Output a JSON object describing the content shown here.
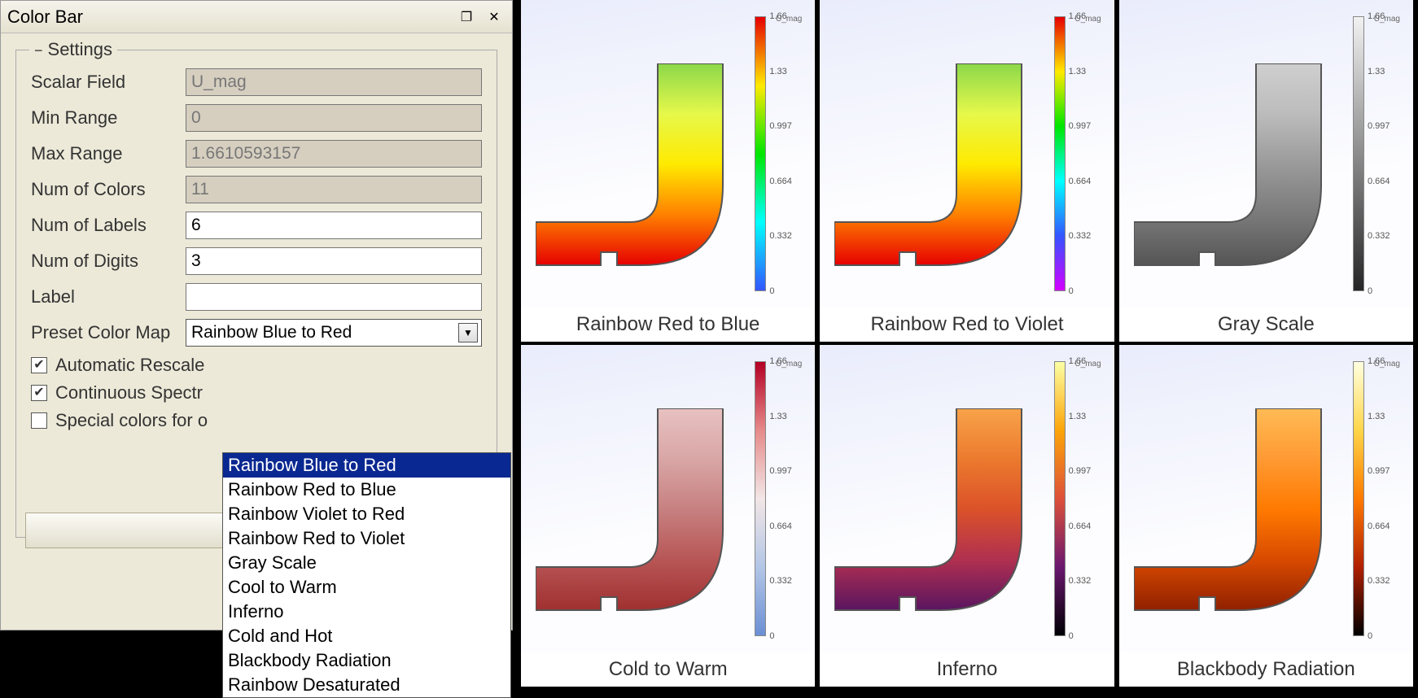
{
  "panel": {
    "title": "Color Bar",
    "group_title": "Settings",
    "fields": {
      "scalar_field": {
        "label": "Scalar Field",
        "value": "U_mag",
        "disabled": true
      },
      "min_range": {
        "label": "Min Range",
        "value": "0",
        "disabled": true
      },
      "max_range": {
        "label": "Max Range",
        "value": "1.6610593157",
        "disabled": true
      },
      "num_colors": {
        "label": "Num of Colors",
        "value": "11",
        "disabled": true
      },
      "num_labels": {
        "label": "Num of Labels",
        "value": "6",
        "disabled": false
      },
      "num_digits": {
        "label": "Num of Digits",
        "value": "3",
        "disabled": false
      },
      "label_text": {
        "label": "Label",
        "value": "",
        "disabled": false
      }
    },
    "preset": {
      "label": "Preset Color Map",
      "selected": "Rainbow Blue to Red",
      "options": [
        "Rainbow Blue to Red",
        "Rainbow Red to Blue",
        "Rainbow Violet to Red",
        "Rainbow Red to Violet",
        "Gray Scale",
        "Cool to Warm",
        "Inferno",
        "Cold and Hot",
        "Blackbody Radiation",
        "Rainbow Desaturated"
      ]
    },
    "checks": {
      "auto_rescale": {
        "label": "Automatic Rescale",
        "checked": true
      },
      "continuous": {
        "label": "Continuous Spectr",
        "checked": true
      },
      "special_oob": {
        "label": "Special colors for o",
        "checked": false
      }
    }
  },
  "legend": {
    "title": "U_mag",
    "ticks": [
      "1.66",
      "1.33",
      "0.997",
      "0.664",
      "0.332",
      "0"
    ]
  },
  "previews": [
    {
      "name": "Rainbow Red to Blue",
      "gradient": [
        "#e60000",
        "#ffea00",
        "#00e600",
        "#00ffff",
        "#3355ff"
      ],
      "body": [
        "#8bd84a",
        "#e6f84a",
        "#ffea00",
        "#ff8000",
        "#e60000"
      ]
    },
    {
      "name": "Rainbow Red to Violet",
      "gradient": [
        "#e60000",
        "#ffea00",
        "#00e600",
        "#00ffff",
        "#3355ff",
        "#d400ff"
      ],
      "body": [
        "#8bd84a",
        "#e6f84a",
        "#ffea00",
        "#ff8000",
        "#e60000"
      ]
    },
    {
      "name": "Gray Scale",
      "gradient": [
        "#f2f2f2",
        "#bfbfbf",
        "#8c8c8c",
        "#595959",
        "#262626"
      ],
      "body": [
        "#cfcfcf",
        "#bcbcbc",
        "#9a9a9a",
        "#7a7a7a",
        "#555555"
      ]
    },
    {
      "name": "Cold to Warm",
      "gradient": [
        "#b30024",
        "#e68a8a",
        "#f2e6e6",
        "#b3c6e6",
        "#6b8fd4"
      ],
      "body": [
        "#e8c1c1",
        "#d9a6a6",
        "#c78080",
        "#b85656",
        "#a03030"
      ]
    },
    {
      "name": "Inferno",
      "gradient": [
        "#fcffa4",
        "#fca50a",
        "#dd513a",
        "#6a176e",
        "#000004"
      ],
      "body": [
        "#f8a34a",
        "#ec7a2e",
        "#db5229",
        "#b03050",
        "#5a1560"
      ]
    },
    {
      "name": "Blackbody Radiation",
      "gradient": [
        "#ffffe0",
        "#ffd54a",
        "#ff7a00",
        "#b02000",
        "#000000"
      ],
      "body": [
        "#ffbb55",
        "#ff9a33",
        "#ff7a00",
        "#d84a00",
        "#902000"
      ]
    }
  ]
}
